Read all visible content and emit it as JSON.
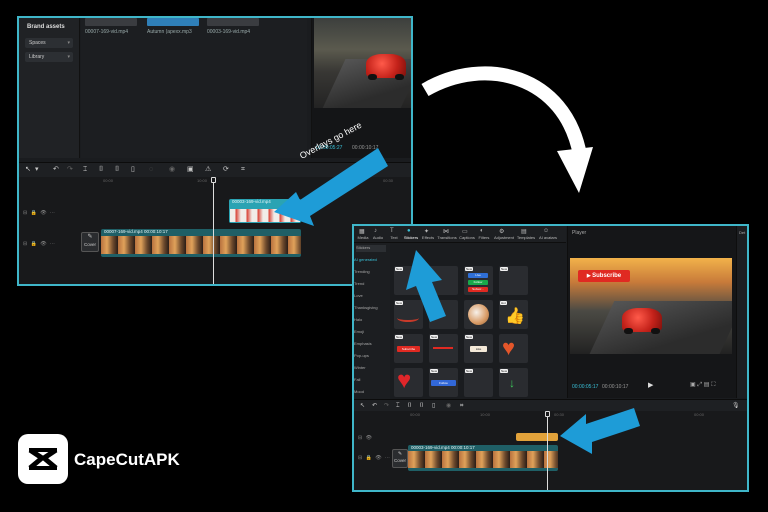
{
  "shot1": {
    "sidebar": {
      "title": "Brand assets",
      "items": [
        {
          "label": "Spaces"
        },
        {
          "label": "Library"
        }
      ]
    },
    "media": [
      {
        "caption": "00007-169-vid.mp4"
      },
      {
        "caption": "Autumn (apexx.mp3"
      },
      {
        "caption": "00003-169-vid.mp4"
      }
    ],
    "player": {
      "current_time": "00:00:05:27",
      "total_time": "00:00:10:17"
    },
    "ruler": [
      "00:00",
      "10:00",
      "00:30"
    ],
    "overlay_clip_label": "00003-169-vid.mp4",
    "main_clip_label": "00007-169-vid.mp4  00:00:10:17",
    "cover_label": "Cover",
    "callout": "Overlays go here"
  },
  "shot2": {
    "tabs": [
      {
        "label": "Media",
        "icon": "grid-icon"
      },
      {
        "label": "Audio",
        "icon": "music-icon"
      },
      {
        "label": "Text",
        "icon": "text-icon"
      },
      {
        "label": "Stickers",
        "icon": "sticker-icon"
      },
      {
        "label": "Effects",
        "icon": "effects-icon"
      },
      {
        "label": "Transitions",
        "icon": "transition-icon"
      },
      {
        "label": "Captions",
        "icon": "caption-icon"
      },
      {
        "label": "Filters",
        "icon": "filter-icon"
      },
      {
        "label": "Adjustment",
        "icon": "adjust-icon"
      },
      {
        "label": "Templates",
        "icon": "template-icon"
      },
      {
        "label": "AI avatars",
        "icon": "avatar-icon"
      }
    ],
    "categories": [
      {
        "label": "Stickers"
      },
      {
        "label": "AI generated"
      },
      {
        "label": "Trending"
      },
      {
        "label": "Trend"
      },
      {
        "label": "Love"
      },
      {
        "label": "Thanksgiving"
      },
      {
        "label": "Halo"
      },
      {
        "label": "Emoji"
      },
      {
        "label": "Emphasis"
      },
      {
        "label": "Pop-ups"
      },
      {
        "label": "Winter"
      },
      {
        "label": "Fall"
      },
      {
        "label": "Mood"
      }
    ],
    "sticker_texts": {
      "subscribe": "Subscribe",
      "follow": "Follow",
      "like": "Like",
      "live": "Live",
      "sub_red": "Subscr..."
    },
    "player": {
      "label": "Player",
      "subscribe_btn": "Subscribe",
      "current_time": "00:00:05:17",
      "total_time": "00:00:10:17"
    },
    "ruler": [
      "00:00",
      "10:00",
      "00:30",
      "00:00"
    ],
    "main_clip_label": "00003-169-vid.mp4  00:00:10:17",
    "cover_label": "Cover",
    "right_label": "Det"
  },
  "brand": {
    "name": "CapeCutAPK"
  },
  "colors": {
    "accent": "#3fb6c9",
    "arrow_blue": "#1e9cd7",
    "subscribe_red": "#e02a22",
    "background": "#000000"
  }
}
